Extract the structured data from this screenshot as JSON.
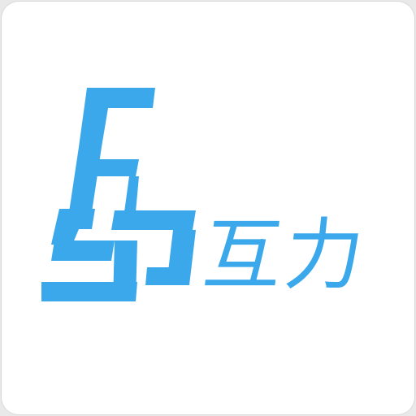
{
  "logo": {
    "wordmark": "互力",
    "brand_color": "#3aa8ea",
    "background_color": "#ffffff",
    "mark_icon": "stylized-F-L-monogram-icon"
  }
}
